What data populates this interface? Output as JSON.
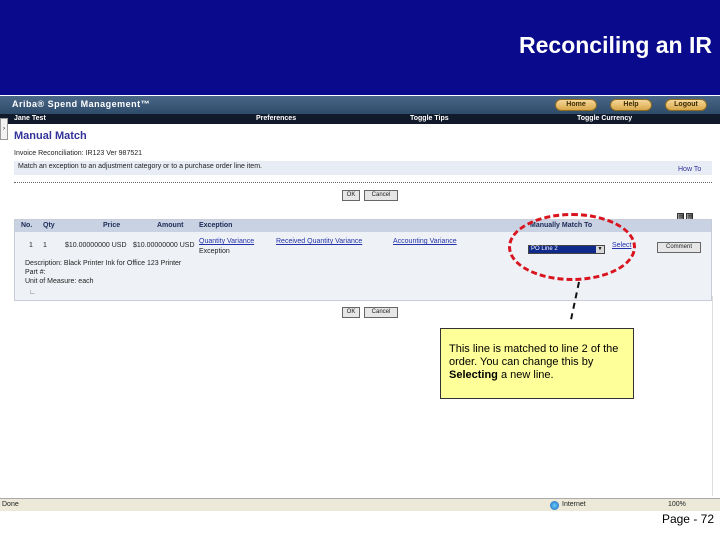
{
  "slide": {
    "title": "Reconciling an IR",
    "page_number": "Page - 72"
  },
  "app": {
    "brand": "Ariba® Spend Management™",
    "user": "Jane Test",
    "top_buttons": [
      "Home",
      "Help",
      "Logout"
    ],
    "menu": [
      "Preferences",
      "Toggle Tips",
      "Toggle Currency"
    ]
  },
  "manual_match": {
    "heading": "Manual Match",
    "invoice_line": "Invoice Reconciliation: IR123 Ver 987521",
    "instruction": "Match an exception to an adjustment category or to a purchase order line item.",
    "how_to": "How To",
    "ok_label": "OK",
    "cancel_label": "Cancel"
  },
  "table": {
    "headers": [
      "No.",
      "Qty",
      "Price",
      "Amount",
      "Exception",
      "Manually Match To"
    ],
    "row": {
      "no": "1",
      "qty": "1",
      "price": "$10.00000000 USD",
      "amount": "$10.00000000 USD",
      "exceptions": [
        "Quantity Variance",
        "Received Quantity Variance",
        "Accounting Variance"
      ],
      "exception_suffix": "Exception",
      "match_value": "PO Line 2",
      "select_label": "Select",
      "comment_label": "Comment",
      "description": "Description: Black Printer Ink for Office 123 Printer",
      "part": "Part #:",
      "uom": "Unit of Measure: each"
    }
  },
  "callout": {
    "text_before": "This line is matched to line 2 of the order.  You can change this by ",
    "text_bold": "Selecting",
    "text_after": " a new line."
  },
  "status_bar": {
    "done": "Done",
    "zone": "Internet",
    "zoom": "100%"
  },
  "colors": {
    "header_bg": "#0a0a8c",
    "callout_bg": "#ffff99",
    "highlight": "#d9141e"
  }
}
